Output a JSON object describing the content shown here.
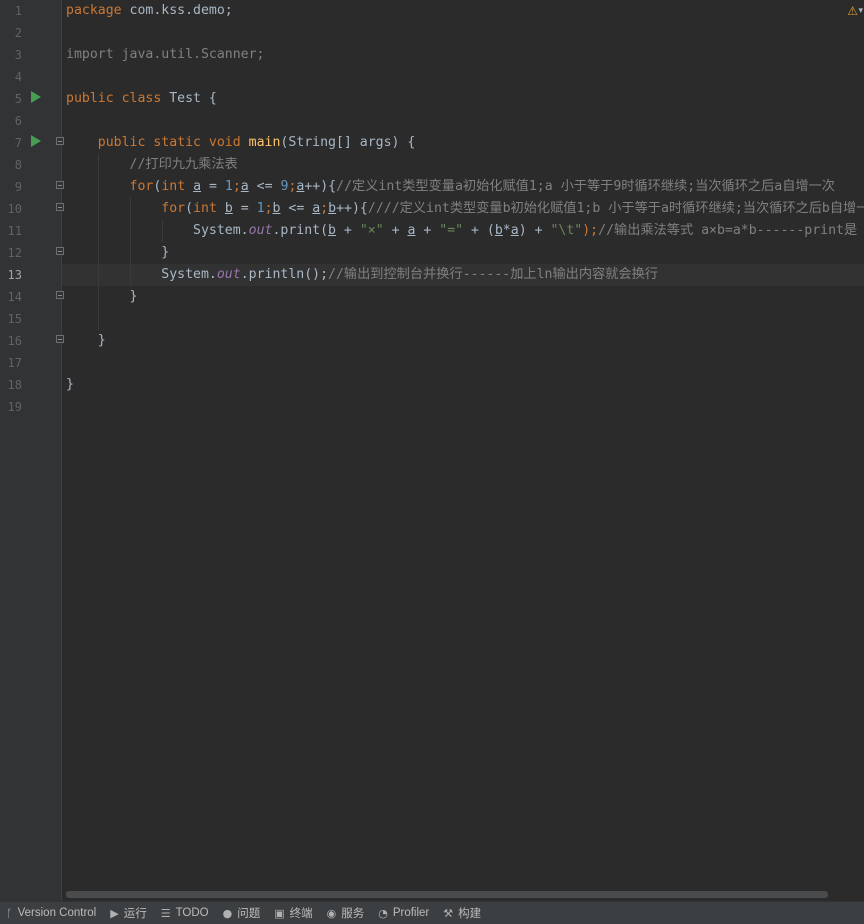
{
  "editor": {
    "line_numbers": [
      "1",
      "2",
      "3",
      "4",
      "5",
      "6",
      "7",
      "8",
      "9",
      "10",
      "11",
      "12",
      "13",
      "14",
      "15",
      "16",
      "17",
      "18",
      "19"
    ],
    "current_line": "13",
    "warning_icon": "warning-icon",
    "code": {
      "l1_package": "package",
      "l1_name": " com.kss.demo;",
      "l3_import": "import java.util.Scanner;",
      "l5_public": "public",
      "l5_class": " class",
      "l5_rest": " Test {",
      "l7_mods": "public static void",
      "l7_main": " main",
      "l7_rest": "(String[] args) {",
      "l8_comment": "//打印九九乘法表",
      "l9_for": "for",
      "l9_p1": "(",
      "l9_int": "int",
      "l9_a1": "a",
      "l9_eq": " = ",
      "l9_1": "1",
      "l9_semi": ";",
      "l9_a2": "a",
      "l9_le": " <= ",
      "l9_9": "9",
      "l9_semi2": ";",
      "l9_a3": "a",
      "l9_inc": "++){",
      "l9_comment": "//定义int类型变量a初始化赋值1;a 小于等于9时循环继续;当次循环之后a自增一次",
      "l10_for": "for",
      "l10_p1": "(",
      "l10_int": "int",
      "l10_b1": "b",
      "l10_eq": " = ",
      "l10_1": "1",
      "l10_semi": ";",
      "l10_b2": "b",
      "l10_le": " <= ",
      "l10_a": "a",
      "l10_semi2": ";",
      "l10_b3": "b",
      "l10_inc": "++){",
      "l10_comment": "////定义int类型变量b初始化赋值1;b 小于等于a时循环继续;当次循环之后b自增一",
      "l11_sys": "System.",
      "l11_out": "out",
      "l11_print": ".print(",
      "l11_b": "b",
      "l11_plus1": " + ",
      "l11_str1": "\"×\"",
      "l11_plus2": " + ",
      "l11_a": "a",
      "l11_plus3": " + ",
      "l11_str2": "\"=\"",
      "l11_plus4": " + (",
      "l11_b2": "b",
      "l11_mul": "*",
      "l11_a2": "a",
      "l11_plus5": ") + ",
      "l11_str3": "\"\\t\"",
      "l11_end": ");",
      "l11_comment": "//输出乘法等式 a×b=a*b------print是",
      "l12_close": "}",
      "l13_sys": "System.",
      "l13_out": "out",
      "l13_println": ".println();",
      "l13_comment": "//输出到控制台并换行------加上ln输出内容就会换行",
      "l14_close": "}",
      "l16_close": "}",
      "l18_close": "}"
    }
  },
  "statusbar": {
    "items": [
      {
        "icon": "version-control-icon",
        "label": "Version Control"
      },
      {
        "icon": "run-icon",
        "label": "运行"
      },
      {
        "icon": "todo-icon",
        "label": "TODO"
      },
      {
        "icon": "problems-icon",
        "label": "问题"
      },
      {
        "icon": "terminal-icon",
        "label": "终端"
      },
      {
        "icon": "services-icon",
        "label": "服务"
      },
      {
        "icon": "profiler-icon",
        "label": "Profiler"
      },
      {
        "icon": "build-icon",
        "label": "构建"
      }
    ]
  }
}
